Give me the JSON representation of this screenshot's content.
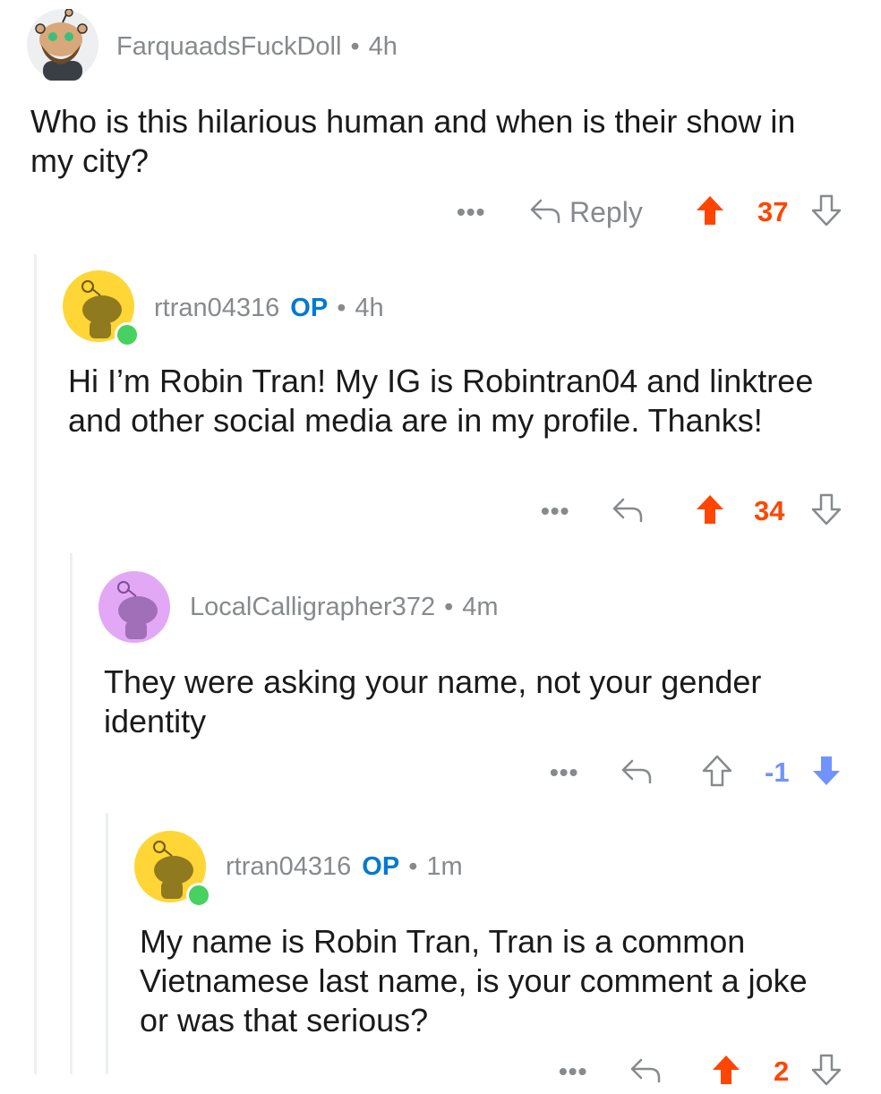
{
  "colors": {
    "upvote": "#ff4500",
    "downvote": "#7193ff",
    "meta": "#878a8c",
    "op_badge": "#0079d3",
    "thread_line": "#edeff1",
    "online": "#46d160"
  },
  "comments": [
    {
      "username": "FarquaadsFuckDoll",
      "separator": "•",
      "time": "4h",
      "body": "Who is this hilarious human and when is their show in my city?",
      "more": "•••",
      "reply_label": "Reply",
      "score": "37",
      "vote_state": "upvoted",
      "avatar_icon": "bearded-snoo-avatar"
    },
    {
      "username": "rtran04316",
      "op_badge": "OP",
      "separator": "•",
      "time": "4h",
      "body": "Hi I’m Robin Tran! My IG is Robintran04 and linktree and other social media are in my profile. Thanks!",
      "more": "•••",
      "score": "34",
      "vote_state": "upvoted",
      "avatar_icon": "yellow-snoo-avatar",
      "online": true
    },
    {
      "username": "LocalCalligrapher372",
      "separator": "•",
      "time": "4m",
      "body": "They were asking your name, not your gender identity",
      "more": "•••",
      "score": "-1",
      "vote_state": "downvoted",
      "avatar_icon": "purple-snoo-avatar"
    },
    {
      "username": "rtran04316",
      "op_badge": "OP",
      "separator": "•",
      "time": "1m",
      "body": "My name is Robin Tran, Tran is a common Vietnamese last name, is your comment a joke or was that serious?",
      "more": "•••",
      "score": "2",
      "vote_state": "upvoted",
      "avatar_icon": "yellow-snoo-avatar",
      "online": true
    }
  ]
}
